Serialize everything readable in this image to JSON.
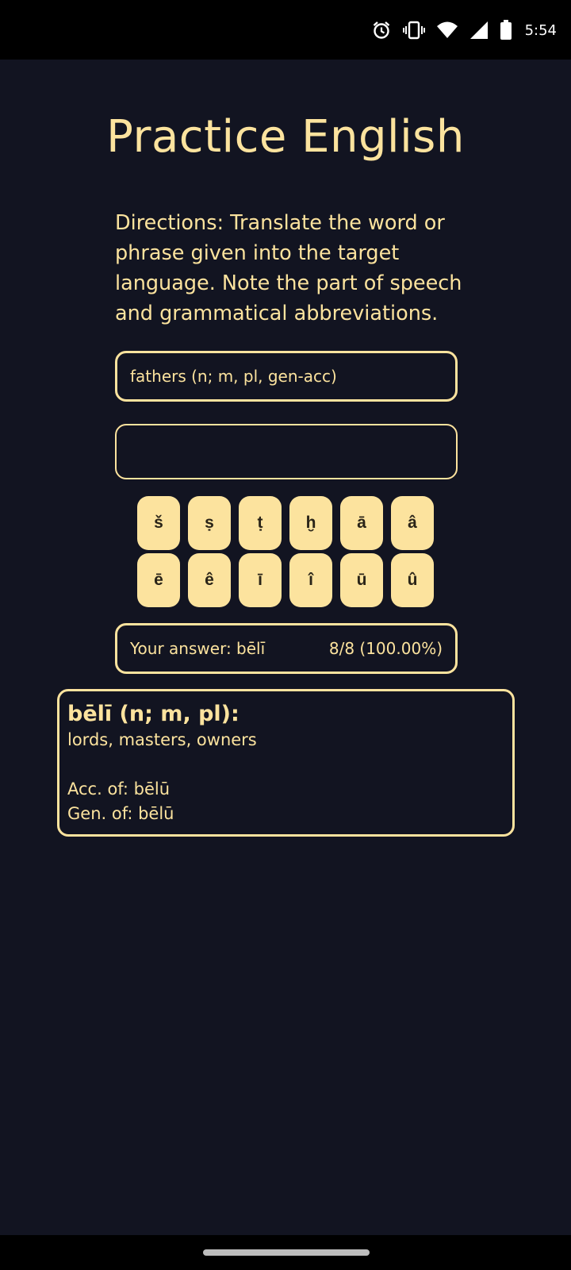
{
  "status_bar": {
    "time": "5:54",
    "icons": [
      "alarm-icon",
      "vibrate-icon",
      "wifi-icon",
      "signal-icon",
      "battery-icon"
    ]
  },
  "page": {
    "title": "Practice English",
    "directions": "Directions: Translate the word or phrase given into the target language. Note the part of speech and grammatical abbreviations."
  },
  "prompt": {
    "text": "fathers (n; m, pl, gen-acc)"
  },
  "answer_input": {
    "value": "",
    "placeholder": ""
  },
  "special_keys": {
    "row1": [
      "š",
      "ṣ",
      "ṭ",
      "ḫ",
      "ā",
      "â"
    ],
    "row2": [
      "ē",
      "ê",
      "ī",
      "î",
      "ū",
      "û"
    ]
  },
  "result": {
    "your_answer": "Your answer: bēlī",
    "score": "8/8 (100.00%)"
  },
  "dictionary": {
    "headword": "bēlī (n; m, pl):",
    "definition": "lords, masters, owners",
    "forms": [
      "Acc. of: bēlū",
      "Gen. of: bēlū"
    ]
  },
  "colors": {
    "background": "#121421",
    "accent": "#fce39e",
    "status_bar": "#000000"
  }
}
